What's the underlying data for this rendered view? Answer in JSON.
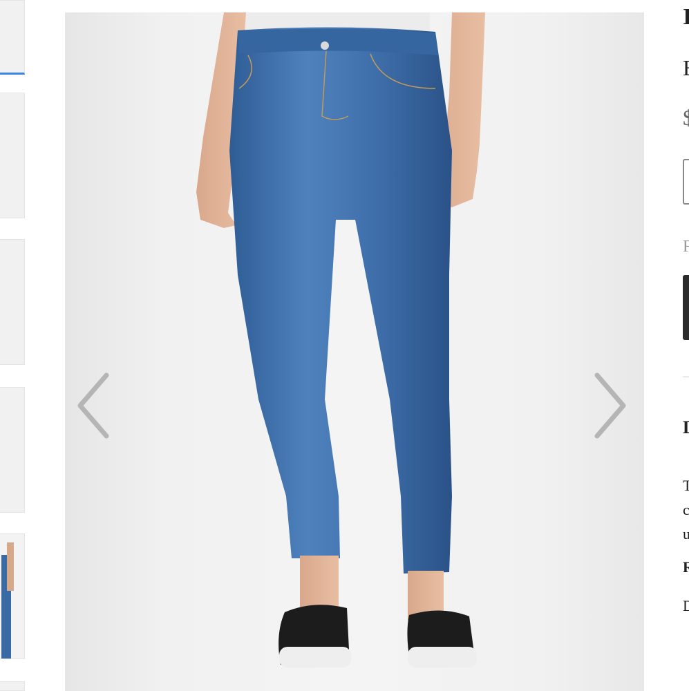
{
  "thumbnails": [
    {
      "label": "thumbnail-1",
      "active": true
    },
    {
      "label": "thumbnail-2",
      "active": false
    },
    {
      "label": "thumbnail-3",
      "active": false
    },
    {
      "label": "thumbnail-4",
      "active": false
    },
    {
      "label": "thumbnail-5",
      "active": false
    }
  ],
  "gallery": {
    "prev_icon": "chevron-left-icon",
    "next_icon": "chevron-right-icon"
  },
  "info_panel": {
    "title_fragment": "I",
    "brand_fragment": "B",
    "price_fragment": "$",
    "label_fragment": "F",
    "section_heading_fragment": "D",
    "desc_line_1": "T",
    "desc_line_2": "c",
    "desc_line_3": "u",
    "detail_1": "R",
    "detail_2": "D"
  },
  "colors": {
    "accent": "#3d84e0",
    "denim": "#3a6aa4",
    "shoe": "#1c1c1c",
    "button": "#2b2b2b"
  }
}
